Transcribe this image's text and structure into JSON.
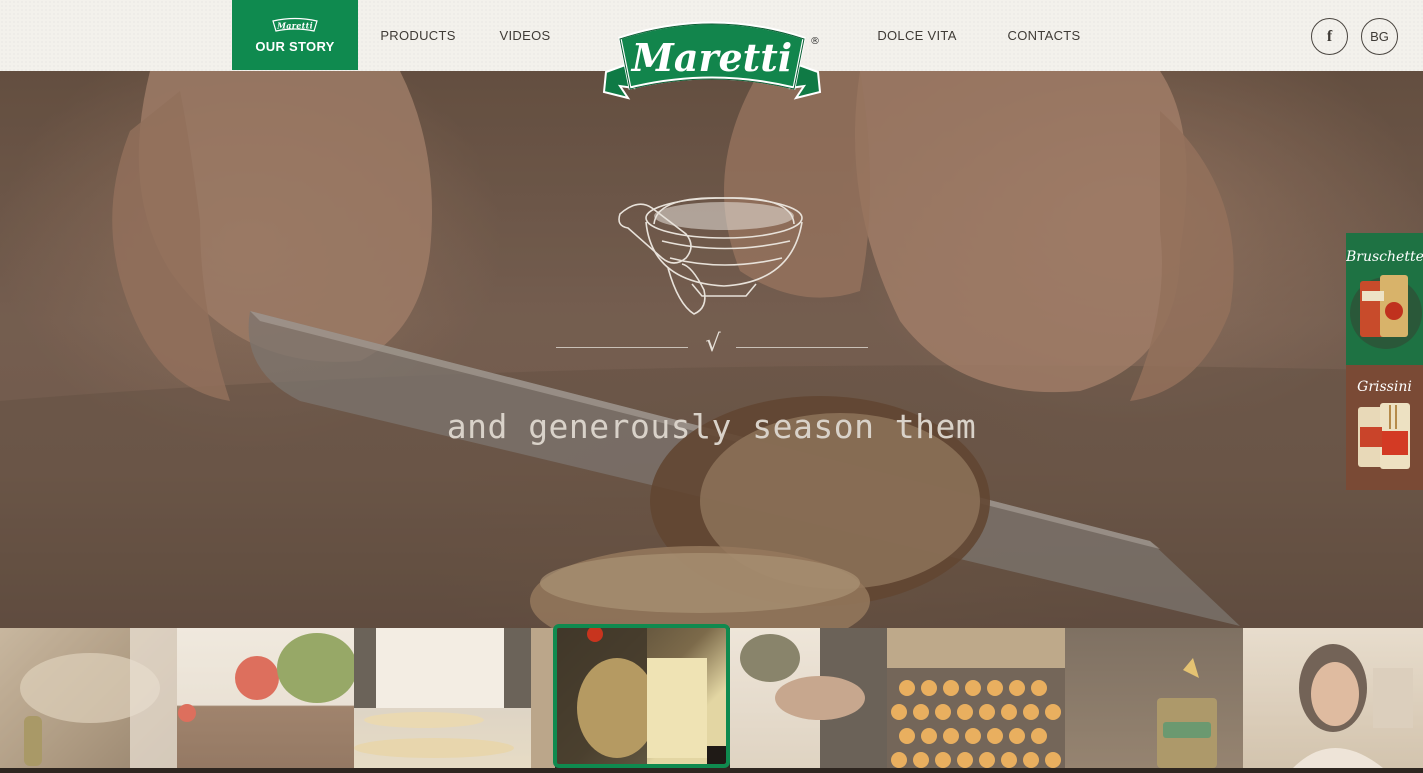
{
  "brand": {
    "name": "Maretti",
    "registered_mark": "®",
    "colors": {
      "primary_green": "#0f8a4f",
      "header_bg": "#f3f1ec",
      "nav_text": "#3f3b36"
    }
  },
  "nav": {
    "items": [
      {
        "label": "OUR STORY",
        "active": true
      },
      {
        "label": "PRODUCTS"
      },
      {
        "label": "VIDEOS"
      },
      {
        "label": "DOLCE VITA"
      },
      {
        "label": "CONTACTS"
      }
    ],
    "social_label": "f",
    "language_label": "BG"
  },
  "hero": {
    "divider_mark": "√",
    "caption": "and generously season them",
    "illustration": "spice-bowl-with-scoop"
  },
  "side_tabs": [
    {
      "label": "Bruschette"
    },
    {
      "label": "Grissini"
    }
  ],
  "filmstrip": {
    "active_index": 3,
    "thumbnails": [
      {
        "name": "flour-and-oil"
      },
      {
        "name": "tomato-and-herbs"
      },
      {
        "name": "chef-rolling-dough"
      },
      {
        "name": "cutting-bread"
      },
      {
        "name": "seasoning-herbs"
      },
      {
        "name": "baking-tray"
      },
      {
        "name": "maretti-package"
      },
      {
        "name": "woman-tasting"
      }
    ]
  }
}
